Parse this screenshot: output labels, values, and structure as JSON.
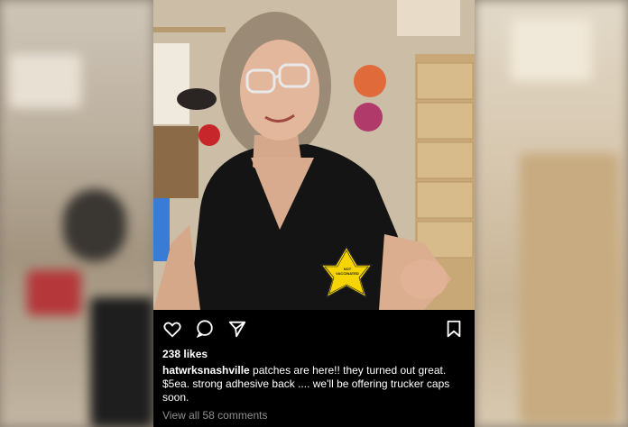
{
  "post": {
    "likes": "238 likes",
    "username": "hatwrksnashville",
    "caption": " patches are here!! they turned out great. $5ea. strong adhesive back .... we'll be offering trucker caps soon.",
    "view_comments": "View all 58 comments",
    "icons": [
      "heart-icon",
      "comment-icon",
      "share-icon",
      "bookmark-icon"
    ]
  },
  "photo": {
    "patch_text": "NOT VACCINATED"
  },
  "colors": {
    "bar_bg": "#000000",
    "text": "#ffffff",
    "muted": "#8e8e8e",
    "patch": "#f5d400"
  }
}
